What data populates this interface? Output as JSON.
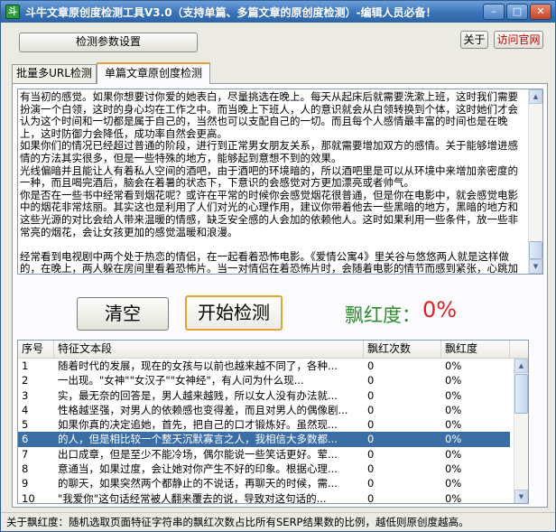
{
  "window": {
    "title": "斗牛文章原创度检测工具V3.0（支持单篇、多篇文章的原创度检测）-编辑人员必备！",
    "app_icon_glyph": "斗"
  },
  "toolbar": {
    "params_label": "检测参数设置",
    "about_label": "关于",
    "visit_label": "访问官网"
  },
  "tabs": [
    {
      "label": "批量多URL检测",
      "active": false
    },
    {
      "label": "单篇文章原创度检测",
      "active": true
    }
  ],
  "article": {
    "text": "有当初的感觉。如果你想要讨你爱的她表白，尽量挑选在晚上。每天从起床后就需要洗漱上班，这时我们需要扮演一个白领，这时的身心均在工作之中。而当晚上下班人，人的意识就会从白领转换到个体，这时她们才会认为这个时间和一切都是属于自己的，当然也可以支配自己的一切。而且每个人感情最丰富的时间也是在晚上，这时防御力会降低，成功率自然会更高。\n如果你们的情况已经超过普通的阶段，进行到正常男女朋友关系，那就需要增加双方的感情。关于能够增进感情的方法其实很多，但是一些特殊的地方，能够起到意想不到的效果。\n光线偏暗并且能让人有着私人空间的酒吧，由于酒吧的环境暗的，所以酒吧里是可以从环境中来增加亲密度的一种，而且喝完酒后，脑会在着暑的状态下，下意识的会感觉对方更加漂亮或者帅气。\n你是否在一些书中经常看到烟花呢？或许在平常的时候你会感觉烟花很普通，但是你在电影中，就会感觉电影中的烟花非常炫丽。其实这也是利用了人们对光的心理作用，建议你带着他去一些黑暗的地方，黑暗的地方和这些光源的对比会给人带来温暖的情感，缺乏安全感的人会加的依赖他人。这时如果利用一些条件，放一些非常亮的烟花，会让女孩更加的感觉温暖和浪漫。\n\n经常看到电视剧中两个处于热恋的情侣，在一起看着恐怖电影。《爱情公寓4》里关谷与悠悠两人就是这样做的，在晚上，两人躲在房间里看着恐怖片。当一对情侣在着恐怖片时，会随着电影的情节而感到紧张，心跳加速，这时的感觉会被认为是爱情，过山车也能达到同样的效果。\n感情的深厚程度意味着未来一起过日子的坚持，恋爱简单，白头偕老却很难，且行且珍惜。"
  },
  "actions": {
    "clear_label": "清空",
    "start_label": "开始检测"
  },
  "score": {
    "label": "飘红度：",
    "value": "0%"
  },
  "table": {
    "columns": [
      "序号",
      "特征文本段",
      "飘红次数",
      "飘红度"
    ],
    "rows": [
      {
        "no": "1",
        "text": "随着时代的发展，现在的女孩与以前也越来越不同了，各种...",
        "count": "0",
        "degree": "0%",
        "selected": false
      },
      {
        "no": "2",
        "text": "一出现。\"女神\"\"女汉子\"\"女神经\"，有人问为什么现...",
        "count": "0",
        "degree": "0%",
        "selected": false
      },
      {
        "no": "3",
        "text": "实，最无奈的回答是，男人越来越贱，所以女人没有办法就...",
        "count": "0",
        "degree": "0%",
        "selected": false
      },
      {
        "no": "4",
        "text": "性格越坚强，对男人的依赖感也变得差，而且对男人的偶像剧...",
        "count": "0",
        "degree": "0%",
        "selected": false
      },
      {
        "no": "5",
        "text": "如果你真的决定追她，首先，把自己的口才锻炼好。虽然现...",
        "count": "0",
        "degree": "0%",
        "selected": false
      },
      {
        "no": "6",
        "text": "的人，但是相比较一个整天沉默寡言之人，我相信大多数都...",
        "count": "0",
        "degree": "0%",
        "selected": true
      },
      {
        "no": "7",
        "text": "出口成章，但是至少不能冷场，偶尔能说一些笑话更好。荤...",
        "count": "0",
        "degree": "0%",
        "selected": false
      },
      {
        "no": "8",
        "text": "意通当，如果过度，会让她对你产生不好的印象。根据心理...",
        "count": "0",
        "degree": "0%",
        "selected": false
      },
      {
        "no": "9",
        "text": "的聊天，如果突然两个都静止的不说话，再聊天的时候，需...",
        "count": "0",
        "degree": "0%",
        "selected": false
      },
      {
        "no": "10",
        "text": "\"我爱你\"这句话经常被人翻来覆去的说，导致对这句话的...",
        "count": "0",
        "degree": "0%",
        "selected": false
      }
    ]
  },
  "status": {
    "text": "关于飘红度：随机选取页面特征字符串的飘红次数占比所有SERP结果数的比例，越低则原创度越高。"
  },
  "icons": {
    "minimize": "minimize-icon",
    "maximize": "maximize-icon",
    "close": "close-icon",
    "scroll_up": "scroll-up-arrow-icon",
    "scroll_down": "scroll-down-arrow-icon"
  },
  "colors": {
    "title_bar": "#3a73b8",
    "score_label": "#2e8b2e",
    "score_value": "#e02020",
    "visit_link": "#c00000",
    "selection": "#3a6ea5",
    "active_accent": "#e6a23a"
  }
}
